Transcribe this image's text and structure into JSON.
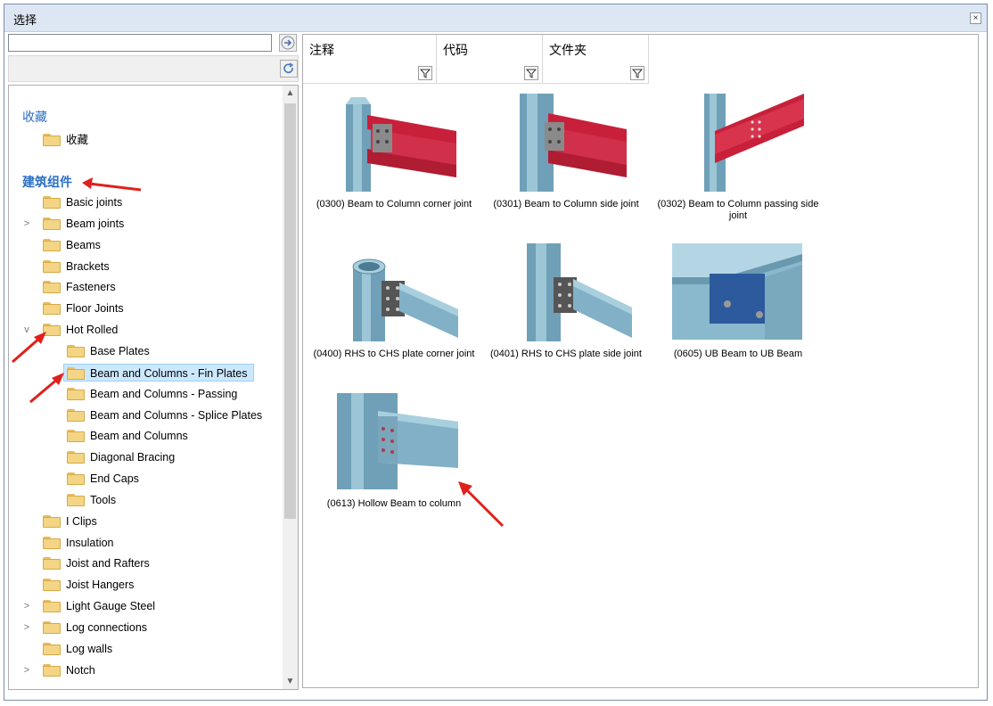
{
  "window": {
    "title": "选择",
    "close_glyph": "×"
  },
  "search": {
    "value": "",
    "placeholder": ""
  },
  "tree": {
    "favorites_heading": "收藏",
    "favorites_item": "收藏",
    "components_heading": "建筑组件",
    "items": [
      {
        "label": "Basic joints",
        "expander": ""
      },
      {
        "label": "Beam joints",
        "expander": ">"
      },
      {
        "label": "Beams",
        "expander": ""
      },
      {
        "label": "Brackets",
        "expander": ""
      },
      {
        "label": "Fasteners",
        "expander": ""
      },
      {
        "label": "Floor Joints",
        "expander": ""
      },
      {
        "label": "Hot Rolled",
        "expander": "v"
      },
      {
        "label": "Base Plates",
        "expander": ""
      },
      {
        "label": "Beam and Columns - Fin Plates",
        "expander": ""
      },
      {
        "label": "Beam and Columns - Passing",
        "expander": ""
      },
      {
        "label": "Beam and Columns - Splice Plates",
        "expander": ""
      },
      {
        "label": "Beam and Columns",
        "expander": ""
      },
      {
        "label": "Diagonal Bracing",
        "expander": ""
      },
      {
        "label": "End Caps",
        "expander": ""
      },
      {
        "label": "Tools",
        "expander": ""
      },
      {
        "label": "I Clips",
        "expander": ""
      },
      {
        "label": "Insulation",
        "expander": ""
      },
      {
        "label": "Joist and Rafters",
        "expander": ""
      },
      {
        "label": "Joist Hangers",
        "expander": ""
      },
      {
        "label": "Light Gauge Steel",
        "expander": ">"
      },
      {
        "label": "Log connections",
        "expander": ">"
      },
      {
        "label": "Log walls",
        "expander": ""
      },
      {
        "label": "Notch",
        "expander": ">"
      }
    ]
  },
  "columns": [
    {
      "label": "注释"
    },
    {
      "label": "代码"
    },
    {
      "label": "文件夹"
    }
  ],
  "tiles": [
    {
      "caption": "(0300) Beam to Column corner joint"
    },
    {
      "caption": "(0301) Beam to Column side joint"
    },
    {
      "caption": "(0302) Beam to Column passing side joint"
    },
    {
      "caption": "(0400) RHS to CHS plate corner joint"
    },
    {
      "caption": "(0401) RHS to CHS plate side joint"
    },
    {
      "caption": "(0605) UB Beam to UB Beam"
    },
    {
      "caption": "(0613) Hollow Beam to column"
    }
  ],
  "colors": {
    "accent": "#2b6fc4",
    "selection": "#cce8ff",
    "annotation_arrow": "#e0201b"
  }
}
